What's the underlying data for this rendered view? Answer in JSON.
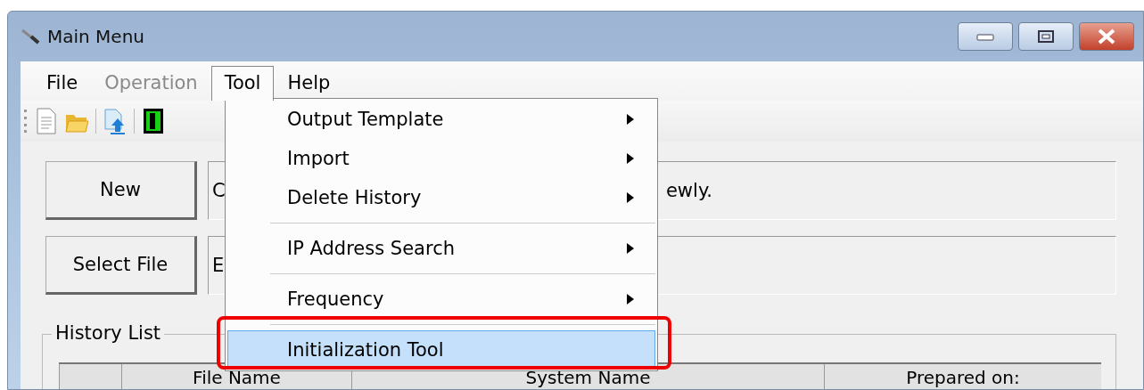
{
  "window": {
    "title": "Main Menu"
  },
  "menu_bar": [
    {
      "label": "File",
      "disabled": false,
      "selected": false
    },
    {
      "label": "Operation",
      "disabled": true,
      "selected": false
    },
    {
      "label": "Tool",
      "disabled": false,
      "selected": true
    },
    {
      "label": "Help",
      "disabled": false,
      "selected": false
    }
  ],
  "toolbar": [
    {
      "kind": "document"
    },
    {
      "kind": "folder"
    },
    {
      "kind": "upload"
    },
    {
      "kind": "exit"
    }
  ],
  "actions": [
    {
      "button": "New",
      "description_start": "C",
      "description_end": "ewly."
    },
    {
      "button": "Select File",
      "description_start": "E"
    }
  ],
  "history_list": {
    "title": "History List",
    "columns": [
      "",
      "File Name",
      "System Name",
      "Prepared on:"
    ]
  },
  "tool_menu": {
    "items": [
      {
        "kind": "item",
        "label": "Output Template",
        "submenu": true,
        "selected": false
      },
      {
        "kind": "item",
        "label": "Import",
        "submenu": true,
        "selected": false
      },
      {
        "kind": "item",
        "label": "Delete History",
        "submenu": true,
        "selected": false
      },
      {
        "kind": "separator"
      },
      {
        "kind": "item",
        "label": "IP Address Search",
        "submenu": true,
        "selected": false
      },
      {
        "kind": "separator"
      },
      {
        "kind": "item",
        "label": "Frequency",
        "submenu": true,
        "selected": false
      },
      {
        "kind": "separator"
      },
      {
        "kind": "item",
        "label": "Initialization Tool",
        "submenu": false,
        "selected": true,
        "highlighted": true
      }
    ]
  }
}
